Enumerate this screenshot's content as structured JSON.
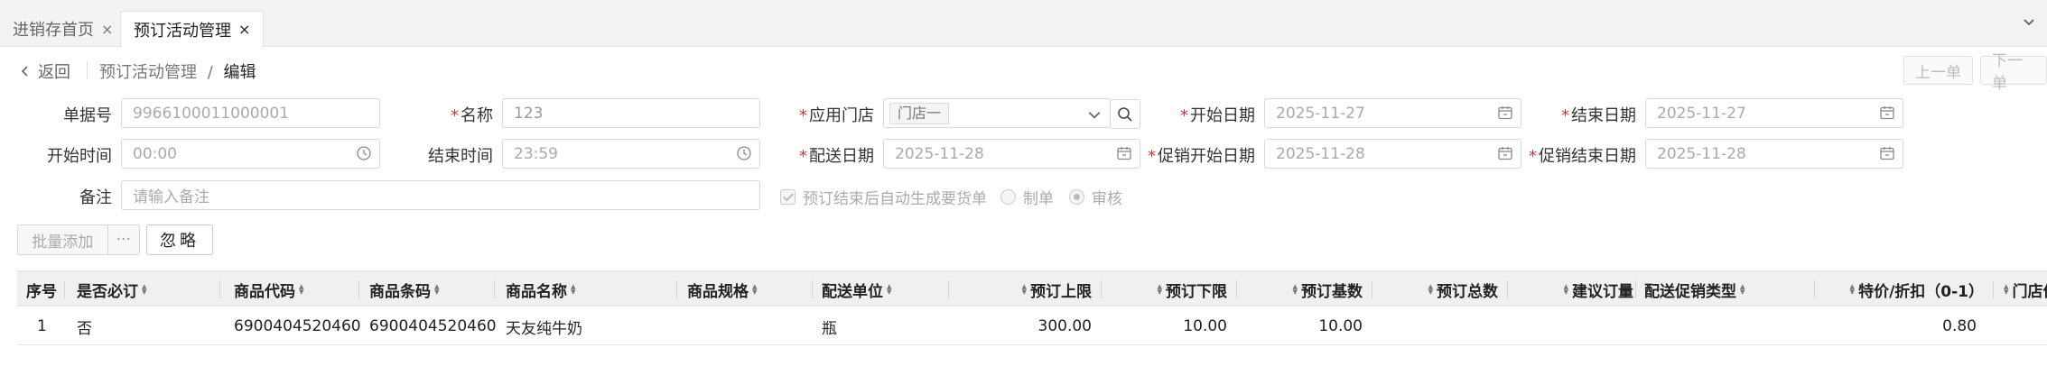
{
  "tabs": [
    {
      "label": "进销存首页",
      "close": "×"
    },
    {
      "label": "预订活动管理",
      "close": "×"
    }
  ],
  "header": {
    "back_label": "返回",
    "breadcrumb_parent": "预订活动管理",
    "breadcrumb_sep": "/",
    "breadcrumb_current": "编辑",
    "prev_label": "上一单",
    "next_label": "下一单"
  },
  "form": {
    "doc_no": {
      "label": "单据号",
      "value": "9966100011000001"
    },
    "name": {
      "label": "名称",
      "required": "*",
      "value": "123"
    },
    "store": {
      "label": "应用门店",
      "required": "*",
      "tag": "门店一"
    },
    "start_date": {
      "label": "开始日期",
      "required": "*",
      "value": "2025-11-27"
    },
    "end_date": {
      "label": "结束日期",
      "required": "*",
      "value": "2025-11-27"
    },
    "start_time": {
      "label": "开始时间",
      "value": "00:00"
    },
    "end_time": {
      "label": "结束时间",
      "value": "23:59"
    },
    "delivery_date": {
      "label": "配送日期",
      "required": "*",
      "value": "2025-11-28"
    },
    "promo_start": {
      "label": "促销开始日期",
      "required": "*",
      "value": "2025-11-28"
    },
    "promo_end": {
      "label": "促销结束日期",
      "required": "*",
      "value": "2025-11-28"
    },
    "remark": {
      "label": "备注",
      "placeholder": "请输入备注"
    },
    "auto_gen": {
      "label": "预订结束后自动生成要货单",
      "checked": true
    },
    "mode_options": [
      "制单",
      "审核"
    ],
    "mode_selected": "审核"
  },
  "toolbar": {
    "batch_add": "批量添加",
    "more": "···",
    "ignore": "忽略"
  },
  "table": {
    "columns": [
      "序号",
      "是否必订",
      "商品代码",
      "商品条码",
      "商品名称",
      "商品规格",
      "配送单位",
      "预订上限",
      "预订下限",
      "预订基数",
      "预订总数",
      "建议订量",
      "配送促销类型",
      "特价/折扣（0-1）",
      "门店价"
    ],
    "rows": [
      {
        "idx": "1",
        "must": "否",
        "code": "6900404520460",
        "barcode": "6900404520460",
        "name": "天友纯牛奶",
        "spec": "",
        "unit": "瓶",
        "upper": "300.00",
        "lower": "10.00",
        "base": "10.00",
        "total": "",
        "suggest": "",
        "promo_type": "",
        "discount": "0.80",
        "store_price": ""
      }
    ]
  }
}
